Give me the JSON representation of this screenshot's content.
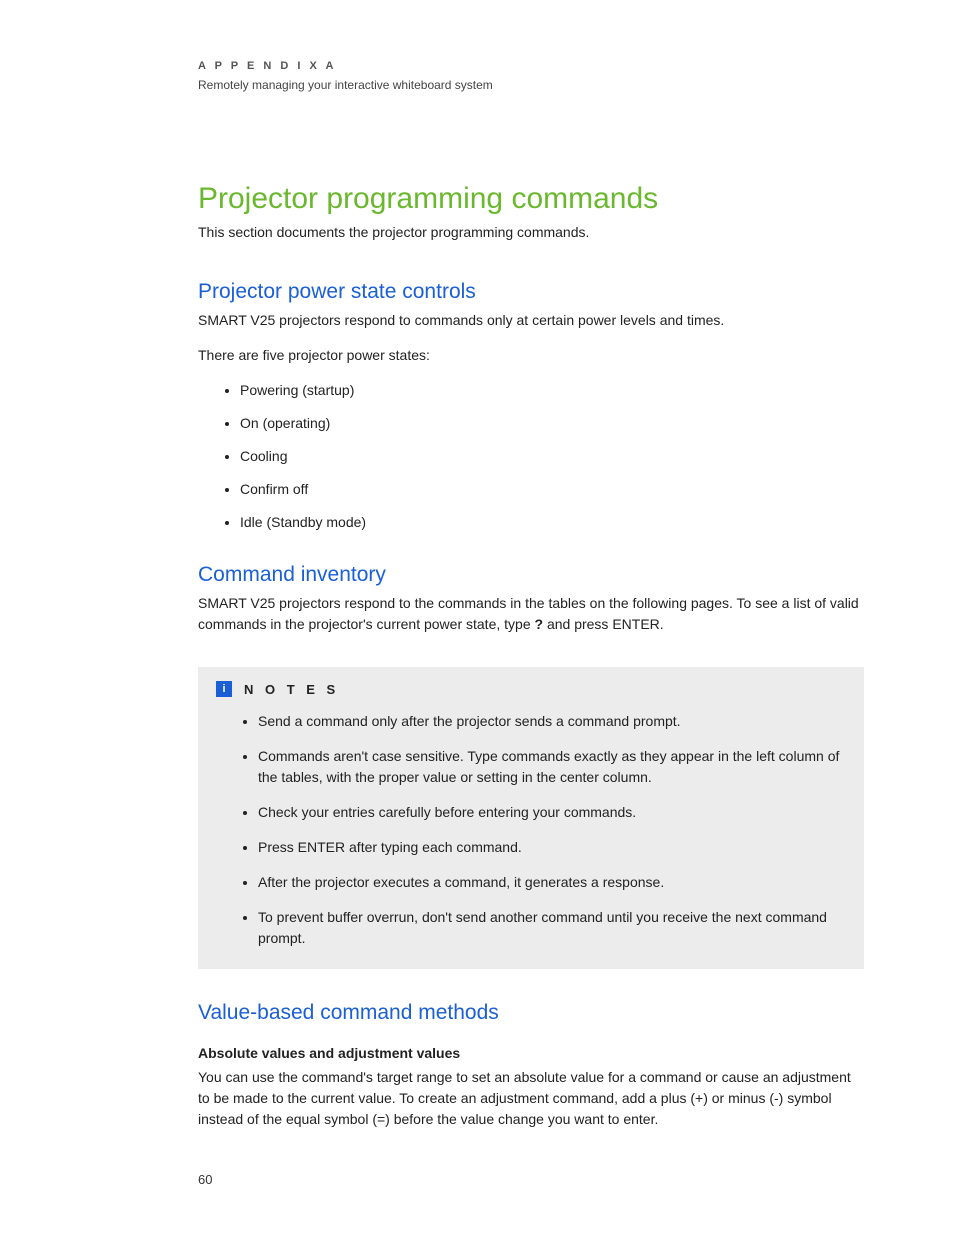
{
  "header": {
    "appendix_label": "A P P E N D I X   A",
    "appendix_subtitle": "Remotely managing your interactive whiteboard system"
  },
  "main_title": "Projector programming commands",
  "intro": "This section documents the projector programming commands.",
  "section1": {
    "heading": "Projector power state controls",
    "para1": "SMART V25 projectors respond to commands only at certain power levels and times.",
    "para2": "There are five projector power states:",
    "bullets": [
      "Powering (startup)",
      "On (operating)",
      "Cooling",
      "Confirm off",
      "Idle (Standby mode)"
    ]
  },
  "section2": {
    "heading": "Command inventory",
    "para_pre": "SMART V25 projectors respond to the commands in the tables on the following pages. To see a list of valid commands in the projector's current power state, type ",
    "para_bold": "?",
    "para_post": " and press ENTER.",
    "notes_label": "N O T E S",
    "info_glyph": "i",
    "notes": [
      "Send a command only after the projector sends a command prompt.",
      "Commands aren't case sensitive. Type commands exactly as they appear in the left column of the tables, with the proper value or setting in the center column.",
      "Check your entries carefully before entering your commands.",
      "Press ENTER after typing each command.",
      "After the projector executes a command, it generates a response.",
      "To prevent buffer overrun, don't send another command until you receive the next command prompt."
    ]
  },
  "section3": {
    "heading": "Value-based command methods",
    "subheading": "Absolute values and adjustment values",
    "para": "You can use the command's target range to set an absolute value for a command or cause an adjustment to be made to the current value. To create an adjustment command, add a plus (+) or minus (-) symbol instead of the equal symbol (=) before the value change you want to enter."
  },
  "page_number": "60"
}
